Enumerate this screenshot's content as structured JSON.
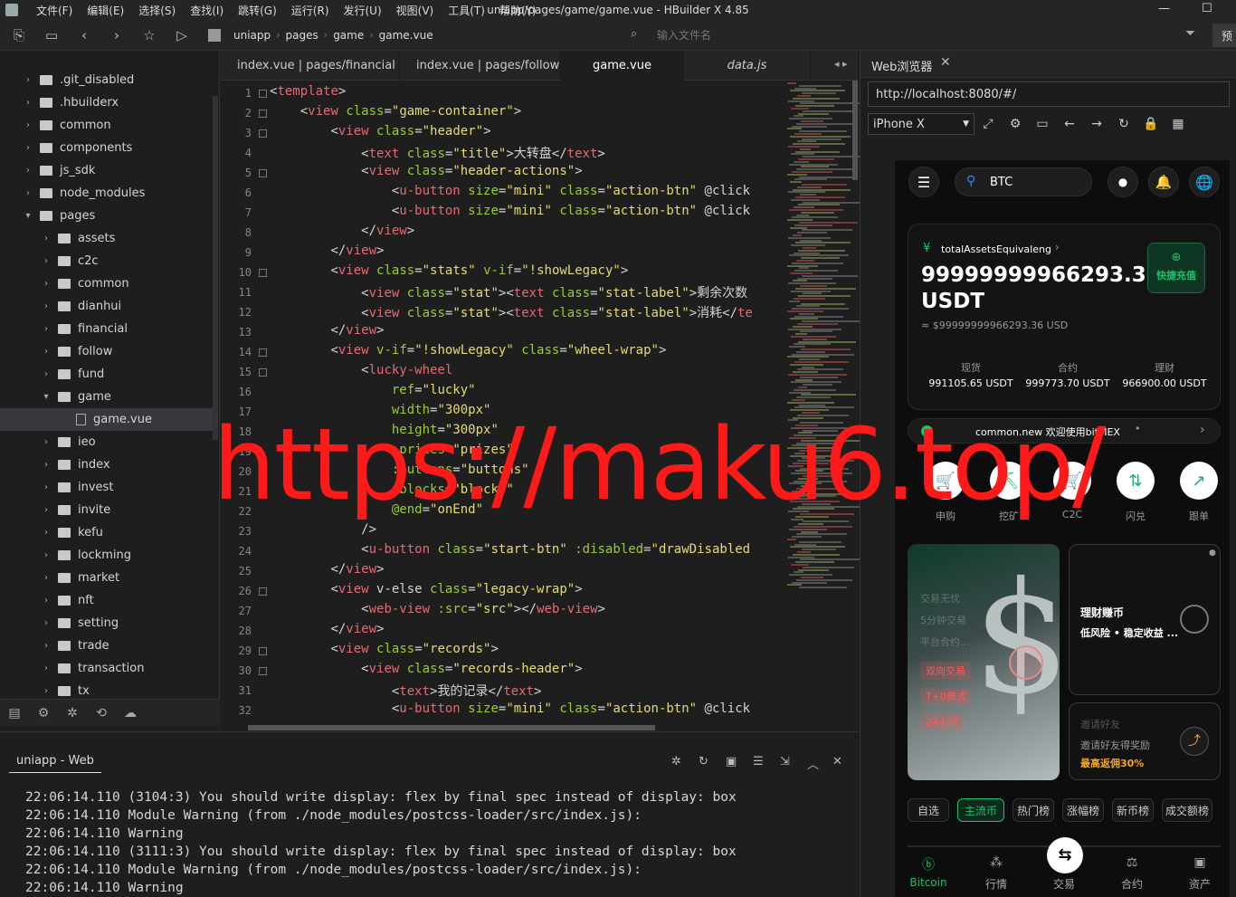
{
  "window": {
    "title": "uniapp/pages/game/game.vue - HBuilder X 4.85",
    "menu": [
      "文件(F)",
      "编辑(E)",
      "选择(S)",
      "查找(I)",
      "跳转(G)",
      "运行(R)",
      "发行(U)",
      "视图(V)",
      "工具(T)",
      "帮助(Y)"
    ]
  },
  "toolbar": {
    "breadcrumb": [
      "uniapp",
      "pages",
      "game",
      "game.vue"
    ],
    "file_placeholder": "输入文件名",
    "preview_label": "预"
  },
  "sidebar": {
    "items": [
      {
        "label": ".git_disabled",
        "arrow": "›",
        "type": "folder",
        "indent": 0
      },
      {
        "label": ".hbuilderx",
        "arrow": "›",
        "type": "folder",
        "indent": 0
      },
      {
        "label": "common",
        "arrow": "›",
        "type": "folder",
        "indent": 0
      },
      {
        "label": "components",
        "arrow": "›",
        "type": "folder",
        "indent": 0
      },
      {
        "label": "js_sdk",
        "arrow": "›",
        "type": "folder",
        "indent": 0
      },
      {
        "label": "node_modules",
        "arrow": "›",
        "type": "folder",
        "indent": 0
      },
      {
        "label": "pages",
        "arrow": "⌄",
        "type": "folder",
        "indent": 0
      },
      {
        "label": "assets",
        "arrow": "›",
        "type": "folder",
        "indent": 1
      },
      {
        "label": "c2c",
        "arrow": "›",
        "type": "folder",
        "indent": 1
      },
      {
        "label": "common",
        "arrow": "›",
        "type": "folder",
        "indent": 1
      },
      {
        "label": "dianhui",
        "arrow": "›",
        "type": "folder",
        "indent": 1
      },
      {
        "label": "financial",
        "arrow": "›",
        "type": "folder",
        "indent": 1
      },
      {
        "label": "follow",
        "arrow": "›",
        "type": "folder",
        "indent": 1
      },
      {
        "label": "fund",
        "arrow": "›",
        "type": "folder",
        "indent": 1
      },
      {
        "label": "game",
        "arrow": "⌄",
        "type": "folder",
        "indent": 1
      },
      {
        "label": "game.vue",
        "arrow": "",
        "type": "file",
        "indent": 2,
        "selected": true
      },
      {
        "label": "ieo",
        "arrow": "›",
        "type": "folder",
        "indent": 1
      },
      {
        "label": "index",
        "arrow": "›",
        "type": "folder",
        "indent": 1
      },
      {
        "label": "invest",
        "arrow": "›",
        "type": "folder",
        "indent": 1
      },
      {
        "label": "invite",
        "arrow": "›",
        "type": "folder",
        "indent": 1
      },
      {
        "label": "kefu",
        "arrow": "›",
        "type": "folder",
        "indent": 1
      },
      {
        "label": "lockming",
        "arrow": "›",
        "type": "folder",
        "indent": 1
      },
      {
        "label": "market",
        "arrow": "›",
        "type": "folder",
        "indent": 1
      },
      {
        "label": "nft",
        "arrow": "›",
        "type": "folder",
        "indent": 1
      },
      {
        "label": "setting",
        "arrow": "›",
        "type": "folder",
        "indent": 1
      },
      {
        "label": "trade",
        "arrow": "›",
        "type": "folder",
        "indent": 1
      },
      {
        "label": "transaction",
        "arrow": "›",
        "type": "folder",
        "indent": 1
      },
      {
        "label": "tx",
        "arrow": "›",
        "type": "folder",
        "indent": 1
      }
    ]
  },
  "tabs": [
    {
      "label": "index.vue | pages/financial",
      "active": false
    },
    {
      "label": "index.vue | pages/follow",
      "active": false
    },
    {
      "label": "game.vue",
      "active": true
    },
    {
      "label": "data.js",
      "active": false,
      "italic": true
    }
  ],
  "editor": {
    "lines": [
      {
        "n": "1",
        "fold": true,
        "code": "<template>"
      },
      {
        "n": "2",
        "fold": true,
        "code": "    <view class=\"game-container\">"
      },
      {
        "n": "3",
        "fold": true,
        "code": "        <view class=\"header\">"
      },
      {
        "n": "4",
        "fold": false,
        "code": "            <text class=\"title\">大转盘</text>"
      },
      {
        "n": "5",
        "fold": true,
        "code": "            <view class=\"header-actions\">"
      },
      {
        "n": "6",
        "fold": false,
        "code": "                <u-button size=\"mini\" class=\"action-btn\" @click"
      },
      {
        "n": "7",
        "fold": false,
        "code": "                <u-button size=\"mini\" class=\"action-btn\" @click"
      },
      {
        "n": "8",
        "fold": false,
        "code": "            </view>"
      },
      {
        "n": "9",
        "fold": false,
        "code": "        </view>"
      },
      {
        "n": "10",
        "fold": true,
        "code": "        <view class=\"stats\" v-if=\"!showLegacy\">"
      },
      {
        "n": "11",
        "fold": false,
        "code": "            <view class=\"stat\"><text class=\"stat-label\">剩余次数"
      },
      {
        "n": "12",
        "fold": false,
        "code": "            <view class=\"stat\"><text class=\"stat-label\">消耗</te"
      },
      {
        "n": "13",
        "fold": false,
        "code": "        </view>"
      },
      {
        "n": "14",
        "fold": true,
        "code": "        <view v-if=\"!showLegacy\" class=\"wheel-wrap\">"
      },
      {
        "n": "15",
        "fold": true,
        "code": "            <lucky-wheel"
      },
      {
        "n": "16",
        "fold": false,
        "code": "                ref=\"lucky\""
      },
      {
        "n": "17",
        "fold": false,
        "code": "                width=\"300px\""
      },
      {
        "n": "18",
        "fold": false,
        "code": "                height=\"300px\""
      },
      {
        "n": "19",
        "fold": false,
        "code": "                :prizes=\"prizes\""
      },
      {
        "n": "20",
        "fold": false,
        "code": "                :buttons=\"buttons\""
      },
      {
        "n": "21",
        "fold": false,
        "code": "                :blocks=\"blocks\""
      },
      {
        "n": "22",
        "fold": false,
        "code": "                @end=\"onEnd\""
      },
      {
        "n": "23",
        "fold": false,
        "code": "            />"
      },
      {
        "n": "24",
        "fold": false,
        "code": "            <u-button class=\"start-btn\" :disabled=\"drawDisabled"
      },
      {
        "n": "25",
        "fold": false,
        "code": "        </view>"
      },
      {
        "n": "26",
        "fold": true,
        "code": "        <view v-else class=\"legacy-wrap\">"
      },
      {
        "n": "27",
        "fold": false,
        "code": "            <web-view :src=\"src\"></web-view>"
      },
      {
        "n": "28",
        "fold": false,
        "code": "        </view>"
      },
      {
        "n": "29",
        "fold": true,
        "code": "        <view class=\"records\">"
      },
      {
        "n": "30",
        "fold": true,
        "code": "            <view class=\"records-header\">"
      },
      {
        "n": "31",
        "fold": false,
        "code": "                <text>我的记录</text>"
      },
      {
        "n": "32",
        "fold": false,
        "code": "                <u-button size=\"mini\" class=\"action-btn\" @click"
      }
    ]
  },
  "watermark": "https://maku6.top/",
  "browser": {
    "tab_label": "Web浏览器",
    "url": "http://localhost:8080/#/",
    "device": "iPhone X",
    "app": {
      "search_text": "BTC",
      "assets_label": "totalAssetsEquivaleng",
      "total": "99999999966293.36",
      "total_unit": "USDT",
      "usd_equiv": "≈ $99999999966293.36 USD",
      "recharge_label": "快捷充值",
      "sub_assets": [
        {
          "label": "现货",
          "value": "991105.65 USDT"
        },
        {
          "label": "合约",
          "value": "999773.70 USDT"
        },
        {
          "label": "理财",
          "value": "966900.00 USDT"
        }
      ],
      "notice": "common.new 欢迎使用bitMEX",
      "quick_actions": [
        {
          "label": "申购",
          "icon": "🛒"
        },
        {
          "label": "挖矿",
          "icon": "⛏"
        },
        {
          "label": "C2C",
          "icon": "🛒"
        },
        {
          "label": "闪兑",
          "icon": "⇅"
        },
        {
          "label": "跟单",
          "icon": "↗"
        }
      ],
      "promo_tags": [
        "双向交易",
        "T+0模式",
        "24小时"
      ],
      "promo_faded": [
        "交易无忧",
        "5分钟交易",
        "平台合约..."
      ],
      "finance_title": "理财赚币",
      "finance_sub": "低风险 • 稳定收益 ...",
      "invite_title": "邀请好友",
      "invite_sub": "邀请好友得奖励",
      "invite_rebate": "最高返佣30%",
      "categories": [
        {
          "label": "自选",
          "active": false
        },
        {
          "label": "主流币",
          "active": true
        },
        {
          "label": "热门榜",
          "active": false
        },
        {
          "label": "涨幅榜",
          "active": false
        },
        {
          "label": "新币榜",
          "active": false
        },
        {
          "label": "成交额榜",
          "active": false
        }
      ],
      "bottom_nav": [
        {
          "label": "Bitcoin",
          "active": true
        },
        {
          "label": "行情",
          "active": false
        },
        {
          "label": "交易",
          "active": false
        },
        {
          "label": "合约",
          "active": false
        },
        {
          "label": "资产",
          "active": false
        }
      ]
    }
  },
  "console": {
    "tab_label": "uniapp - Web",
    "lines": [
      "22:06:14.110 (3104:3) You should write display: flex by final spec instead of display: box",
      "22:06:14.110 Module Warning (from ./node_modules/postcss-loader/src/index.js):",
      "22:06:14.110 Warning",
      "22:06:14.110 (3111:3) You should write display: flex by final spec instead of display: box",
      "22:06:14.110 Module Warning (from ./node_modules/postcss-loader/src/index.js):",
      "22:06:14.110 Warning"
    ]
  }
}
